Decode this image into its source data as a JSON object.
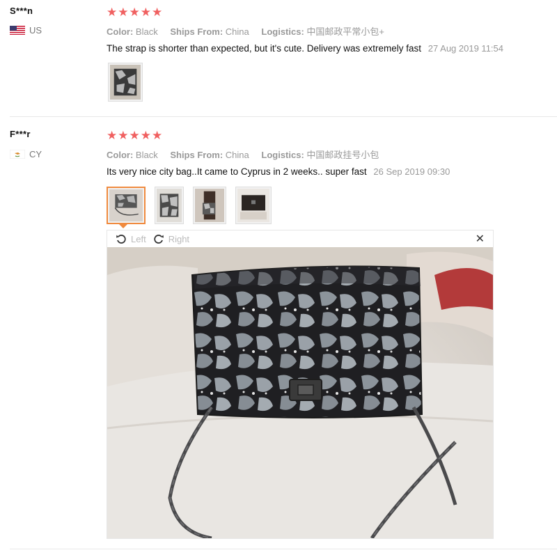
{
  "reviews": [
    {
      "user": "S***n",
      "country": "US",
      "rating": 5,
      "color_label": "Color:",
      "color": "Black",
      "ships_label": "Ships From:",
      "ships": "China",
      "logistics_label": "Logistics:",
      "logistics": "中国邮政平常小包+",
      "text": "The strap is shorter than expected, but it's cute. Delivery was extremely fast",
      "date": "27 Aug 2019 11:54"
    },
    {
      "user": "F***r",
      "country": "CY",
      "rating": 5,
      "color_label": "Color:",
      "color": "Black",
      "ships_label": "Ships From:",
      "ships": "China",
      "logistics_label": "Logistics:",
      "logistics": "中国邮政挂号小包",
      "text": "Its very nice city bag..It came to Cyprus in 2 weeks.. super fast",
      "date": "26 Sep 2019 09:30"
    }
  ],
  "viewer": {
    "rotate_left": "Left",
    "rotate_right": "Right",
    "close_icon": "close-icon"
  },
  "colors": {
    "star": "#f06060",
    "active_thumb": "#f08a3e",
    "meta_gray": "#999999"
  }
}
